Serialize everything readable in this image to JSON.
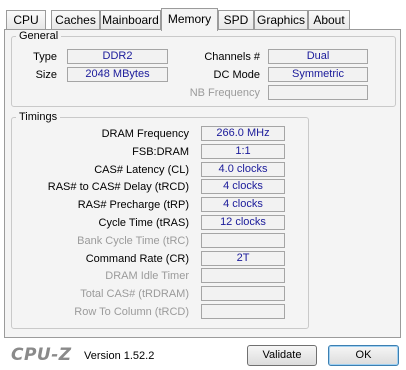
{
  "tabs": [
    "CPU",
    "Caches",
    "Mainboard",
    "Memory",
    "SPD",
    "Graphics",
    "About"
  ],
  "active_tab": "Memory",
  "general": {
    "legend": "General",
    "type_label": "Type",
    "type_value": "DDR2",
    "size_label": "Size",
    "size_value": "2048 MBytes",
    "channels_label": "Channels #",
    "channels_value": "Dual",
    "dc_mode_label": "DC Mode",
    "dc_mode_value": "Symmetric",
    "nb_freq_label": "NB Frequency",
    "nb_freq_value": ""
  },
  "timings": {
    "legend": "Timings",
    "rows": [
      {
        "label": "DRAM Frequency",
        "value": "266.0 MHz",
        "enabled": true
      },
      {
        "label": "FSB:DRAM",
        "value": "1:1",
        "enabled": true
      },
      {
        "label": "CAS# Latency (CL)",
        "value": "4.0 clocks",
        "enabled": true
      },
      {
        "label": "RAS# to CAS# Delay (tRCD)",
        "value": "4 clocks",
        "enabled": true
      },
      {
        "label": "RAS# Precharge (tRP)",
        "value": "4 clocks",
        "enabled": true
      },
      {
        "label": "Cycle Time (tRAS)",
        "value": "12 clocks",
        "enabled": true
      },
      {
        "label": "Bank Cycle Time (tRC)",
        "value": "",
        "enabled": false
      },
      {
        "label": "Command Rate (CR)",
        "value": "2T",
        "enabled": true
      },
      {
        "label": "DRAM Idle Timer",
        "value": "",
        "enabled": false
      },
      {
        "label": "Total CAS# (tRDRAM)",
        "value": "",
        "enabled": false
      },
      {
        "label": "Row To Column (tRCD)",
        "value": "",
        "enabled": false
      }
    ]
  },
  "footer": {
    "logo": "CPU-Z",
    "version": "Version 1.52.2",
    "validate_label": "Validate",
    "ok_label": "OK"
  }
}
